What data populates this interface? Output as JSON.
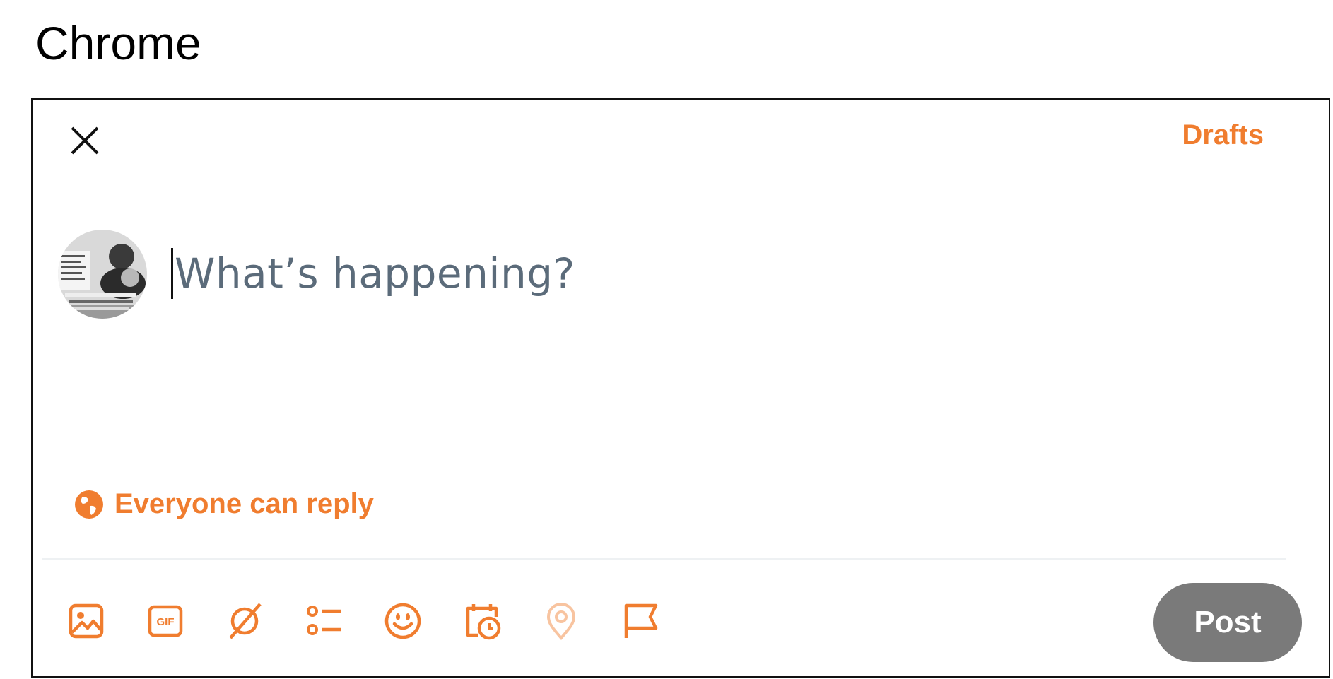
{
  "window": {
    "app_label": "Chrome"
  },
  "header": {
    "drafts_label": "Drafts"
  },
  "composer": {
    "placeholder": "What’s happening?"
  },
  "reply_setting": {
    "label": "Everyone can reply"
  },
  "toolbar": {
    "items": [
      {
        "icon": "image-icon"
      },
      {
        "icon": "gif-icon",
        "text": "GIF"
      },
      {
        "icon": "grok-icon"
      },
      {
        "icon": "poll-icon"
      },
      {
        "icon": "emoji-icon"
      },
      {
        "icon": "schedule-icon"
      },
      {
        "icon": "location-icon",
        "disabled": true
      },
      {
        "icon": "flag-icon"
      }
    ]
  },
  "post_button": {
    "label": "Post"
  },
  "colors": {
    "accent": "#f07d2f",
    "post_disabled": "#7a7a7a",
    "placeholder": "#5b6b7a"
  }
}
